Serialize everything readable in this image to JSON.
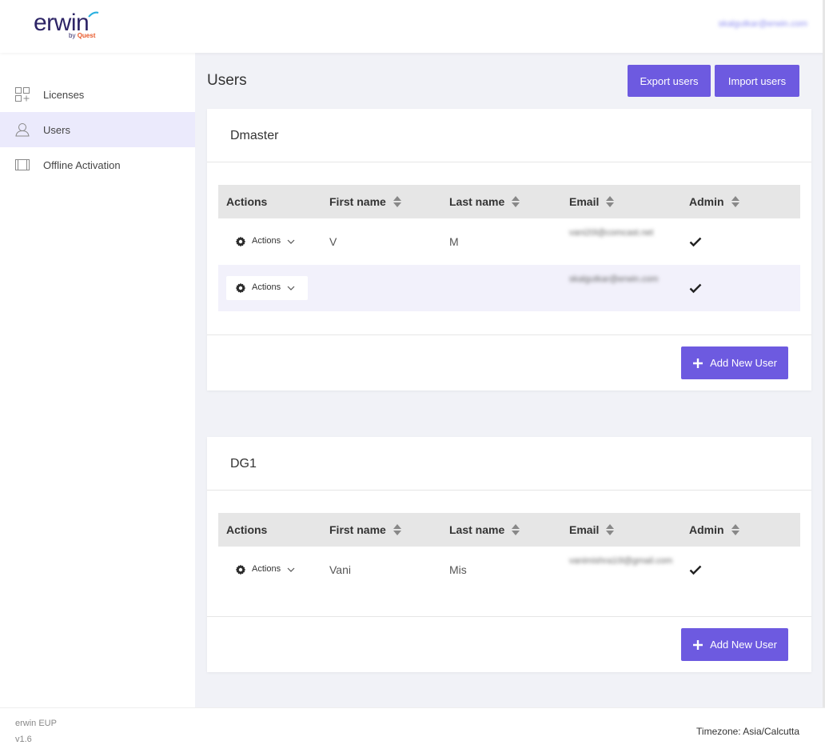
{
  "header": {
    "logo_text": "erwin",
    "logo_by": "by",
    "logo_brand": "Quest",
    "user_email": "skalgutkar@erwin.com"
  },
  "sidebar": {
    "items": [
      {
        "label": "Licenses",
        "icon": "licenses-icon",
        "active": false
      },
      {
        "label": "Users",
        "icon": "users-icon",
        "active": true
      },
      {
        "label": "Offline Activation",
        "icon": "offline-activation-icon",
        "active": false
      }
    ]
  },
  "main": {
    "title": "Users",
    "export_label": "Export users",
    "import_label": "Import users"
  },
  "table_headers": {
    "actions": "Actions",
    "first_name": "First name",
    "last_name": "Last name",
    "email": "Email",
    "admin": "Admin"
  },
  "groups": [
    {
      "name": "Dmaster",
      "rows": [
        {
          "action_label": "Actions",
          "first_name": "V",
          "last_name": "M",
          "email": "vani20l@comcast.net",
          "admin": true
        },
        {
          "action_label": "Actions",
          "first_name": "",
          "last_name": "",
          "email": "skalgutkar@erwin.com",
          "admin": true
        }
      ],
      "add_label": "Add New User"
    },
    {
      "name": "DG1",
      "rows": [
        {
          "action_label": "Actions",
          "first_name": "Vani",
          "last_name": "Mis",
          "email": "vanimishra10l@gmail.com",
          "admin": true
        }
      ],
      "add_label": "Add New User"
    }
  ],
  "footer": {
    "app_name": "erwin EUP",
    "version": "v1.6",
    "timezone": "Timezone: Asia/Calcutta"
  },
  "colors": {
    "accent": "#6d5ae0",
    "active_nav": "#ebeafc",
    "table_header": "#e6e6e6"
  }
}
